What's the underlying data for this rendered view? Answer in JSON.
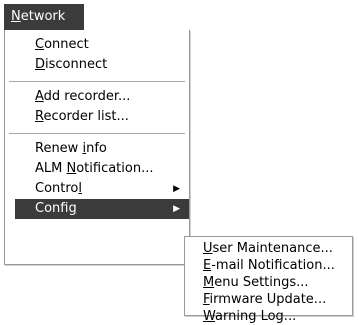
{
  "menubar": {
    "network": {
      "accel": "N",
      "rest": "etwork"
    }
  },
  "network_menu": {
    "connect": {
      "accel": "C",
      "rest": "onnect"
    },
    "disconnect": {
      "accel": "D",
      "rest": "isconnect"
    },
    "add_recorder": {
      "accel": "A",
      "rest": "dd recorder..."
    },
    "recorder_list": {
      "accel": "R",
      "rest": "ecorder list..."
    },
    "renew_info": {
      "before": "Renew ",
      "accel": "i",
      "rest": "nfo"
    },
    "alm_notification": {
      "before": "ALM ",
      "accel": "N",
      "rest": "otification..."
    },
    "control": {
      "before": "Contro",
      "accel": "l",
      "rest": ""
    },
    "config": {
      "before": "Confi",
      "accel": "g",
      "rest": ""
    },
    "arrow_icon": "right-triangle"
  },
  "config_submenu": {
    "user_maintenance": {
      "accel": "U",
      "rest": "ser Maintenance..."
    },
    "email_notification": {
      "accel": "E",
      "rest": "-mail Notification..."
    },
    "menu_settings": {
      "accel": "M",
      "rest": "enu Settings..."
    },
    "firmware_update": {
      "accel": "F",
      "rest": "irmware Update..."
    },
    "warning_log": {
      "accel": "W",
      "rest": "arning Log..."
    }
  },
  "colors": {
    "highlight_bg": "#3b3b3b",
    "highlight_fg": "#ffffff",
    "menu_border": "#9a9a9a"
  }
}
